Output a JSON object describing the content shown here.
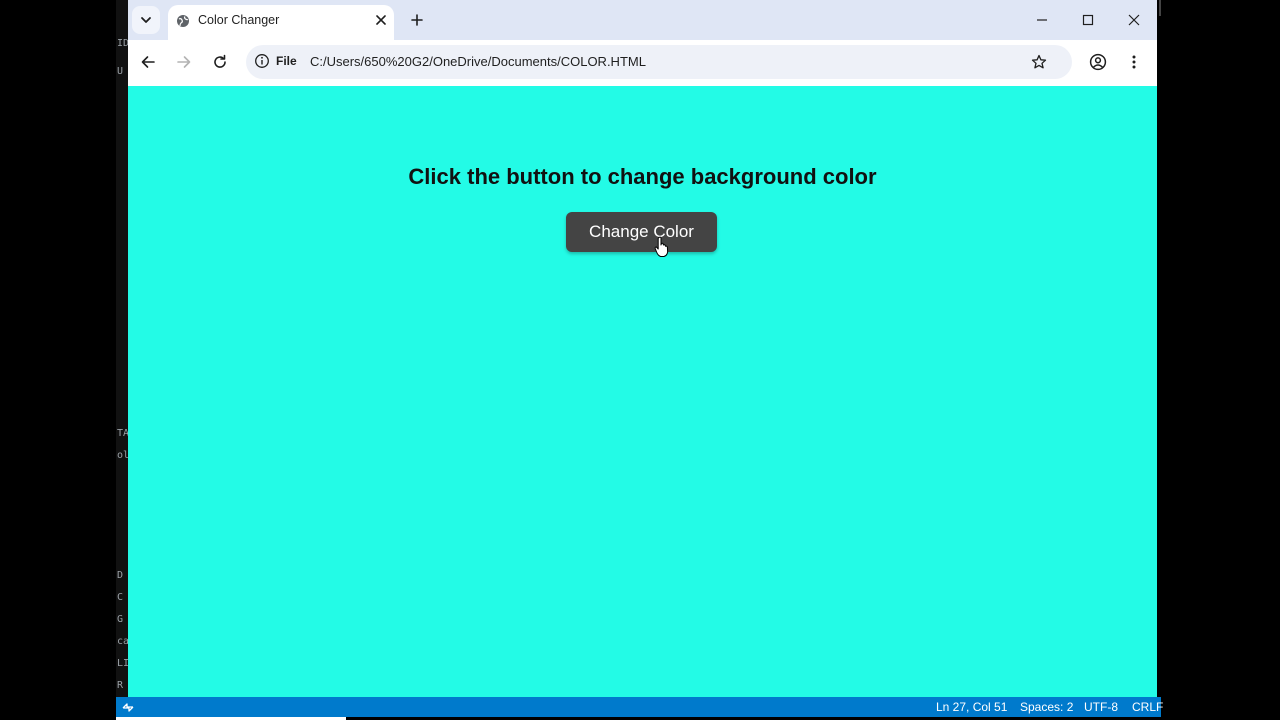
{
  "browser": {
    "tab": {
      "title": "Color Changer"
    },
    "address": {
      "chip_label": "File",
      "url": "C:/Users/650%20G2/OneDrive/Documents/COLOR.HTML"
    }
  },
  "page": {
    "heading": "Click the button to change background color",
    "button_label": "Change Color",
    "background_color": "#23fbe6",
    "button_color": "#444444"
  },
  "statusbar": {
    "position": "Ln 27, Col 51",
    "indentation": "Spaces: 2",
    "encoding": "UTF-8",
    "line_ending": "CRLF",
    "color": "#007acc"
  },
  "icons": {
    "tab_search": "chevron-down-icon",
    "favicon": "globe-icon",
    "close": "close-icon",
    "new_tab": "plus-icon",
    "back": "arrow-left-icon",
    "forward": "arrow-right-icon",
    "reload": "reload-icon",
    "site_info": "info-icon",
    "bookmark": "star-icon",
    "profile": "profile-icon",
    "menu": "kebab-menu-icon"
  }
}
